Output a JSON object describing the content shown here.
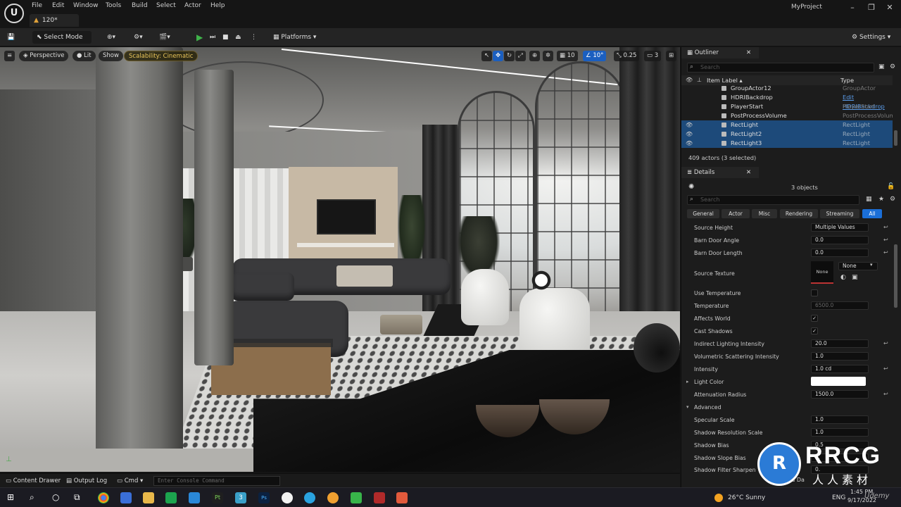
{
  "menu": {
    "items": [
      "File",
      "Edit",
      "Window",
      "Tools",
      "Build",
      "Select",
      "Actor",
      "Help"
    ],
    "level_tab": "120*",
    "project": "MyProject",
    "logo_icon": "unreal-engine-logo"
  },
  "toolbar": {
    "select_mode": "Select Mode",
    "platforms": "Platforms",
    "settings": "Settings"
  },
  "viewport": {
    "perspective": "Perspective",
    "lit": "Lit",
    "show": "Show",
    "scalability": "Scalability: Cinematic",
    "grid_size": "10",
    "rotation_snap": "10°",
    "scale_snap": "0.25",
    "camera_speed": "3"
  },
  "outliner": {
    "title": "Outliner",
    "search_placeholder": "Search",
    "col_label": "Item Label ▴",
    "col_type": "Type",
    "rows": [
      {
        "name": "GroupActor12",
        "type": "GroupActor",
        "selected": false
      },
      {
        "name": "HDRIBackdrop",
        "type": "Edit HDRIBackdrop",
        "selected": false
      },
      {
        "name": "PlayerStart",
        "type": "PlayerStart",
        "selected": false
      },
      {
        "name": "PostProcessVolume",
        "type": "PostProcessVolum",
        "selected": false
      },
      {
        "name": "RectLight",
        "type": "RectLight",
        "selected": true
      },
      {
        "name": "RectLight2",
        "type": "RectLight",
        "selected": true
      },
      {
        "name": "RectLight3",
        "type": "RectLight",
        "selected": true
      }
    ],
    "count": "409 actors (3 selected)"
  },
  "details": {
    "title": "Details",
    "objects": "3 objects",
    "search_placeholder": "Search",
    "categories": [
      "General",
      "Actor",
      "Misc",
      "Rendering",
      "Streaming",
      "All"
    ],
    "props": {
      "source_height": {
        "label": "Source Height",
        "value": "Multiple Values"
      },
      "barn_angle": {
        "label": "Barn Door Angle",
        "value": "0.0"
      },
      "barn_length": {
        "label": "Barn Door Length",
        "value": "0.0"
      },
      "source_texture": {
        "label": "Source Texture",
        "thumb": "None",
        "value": "None"
      },
      "use_temp": {
        "label": "Use Temperature"
      },
      "temperature": {
        "label": "Temperature",
        "value": "6500.0"
      },
      "affects_world": {
        "label": "Affects World"
      },
      "cast_shadows": {
        "label": "Cast Shadows"
      },
      "indirect": {
        "label": "Indirect Lighting Intensity",
        "value": "20.0"
      },
      "volumetric": {
        "label": "Volumetric Scattering Intensity",
        "value": "1.0"
      },
      "intensity": {
        "label": "Intensity",
        "value": "1.0 cd"
      },
      "light_color": {
        "label": "Light Color",
        "color": "#ffffff"
      },
      "atten": {
        "label": "Attenuation Radius",
        "value": "1500.0"
      },
      "advanced": {
        "label": "Advanced"
      },
      "specular": {
        "label": "Specular Scale",
        "value": "1.0"
      },
      "shadow_res": {
        "label": "Shadow Resolution Scale",
        "value": "1.0"
      },
      "shadow_bias": {
        "label": "Shadow Bias",
        "value": "0.5"
      },
      "slope_bias": {
        "label": "Shadow Slope Bias",
        "value": "0."
      },
      "filter_sharpen": {
        "label": "Shadow Filter Sharpen",
        "value": "0."
      }
    }
  },
  "statusbar": {
    "content_drawer": "Content Drawer",
    "output_log": "Output Log",
    "cmd": "Cmd",
    "console_placeholder": "Enter Console Command",
    "derived": "Derived Da"
  },
  "taskbar": {
    "weather": "26°C  Sunny",
    "lang": "ENG",
    "time": "1:45 PM",
    "date": "9/17/2022"
  },
  "watermark": {
    "text": "RRCG",
    "sub": "人人素材",
    "udemy": "Udemy"
  },
  "colors": {
    "accent": "#1b6fd8",
    "selection": "#1d4a7a",
    "scalability": "#e8c45a",
    "play": "#3fb34a"
  }
}
